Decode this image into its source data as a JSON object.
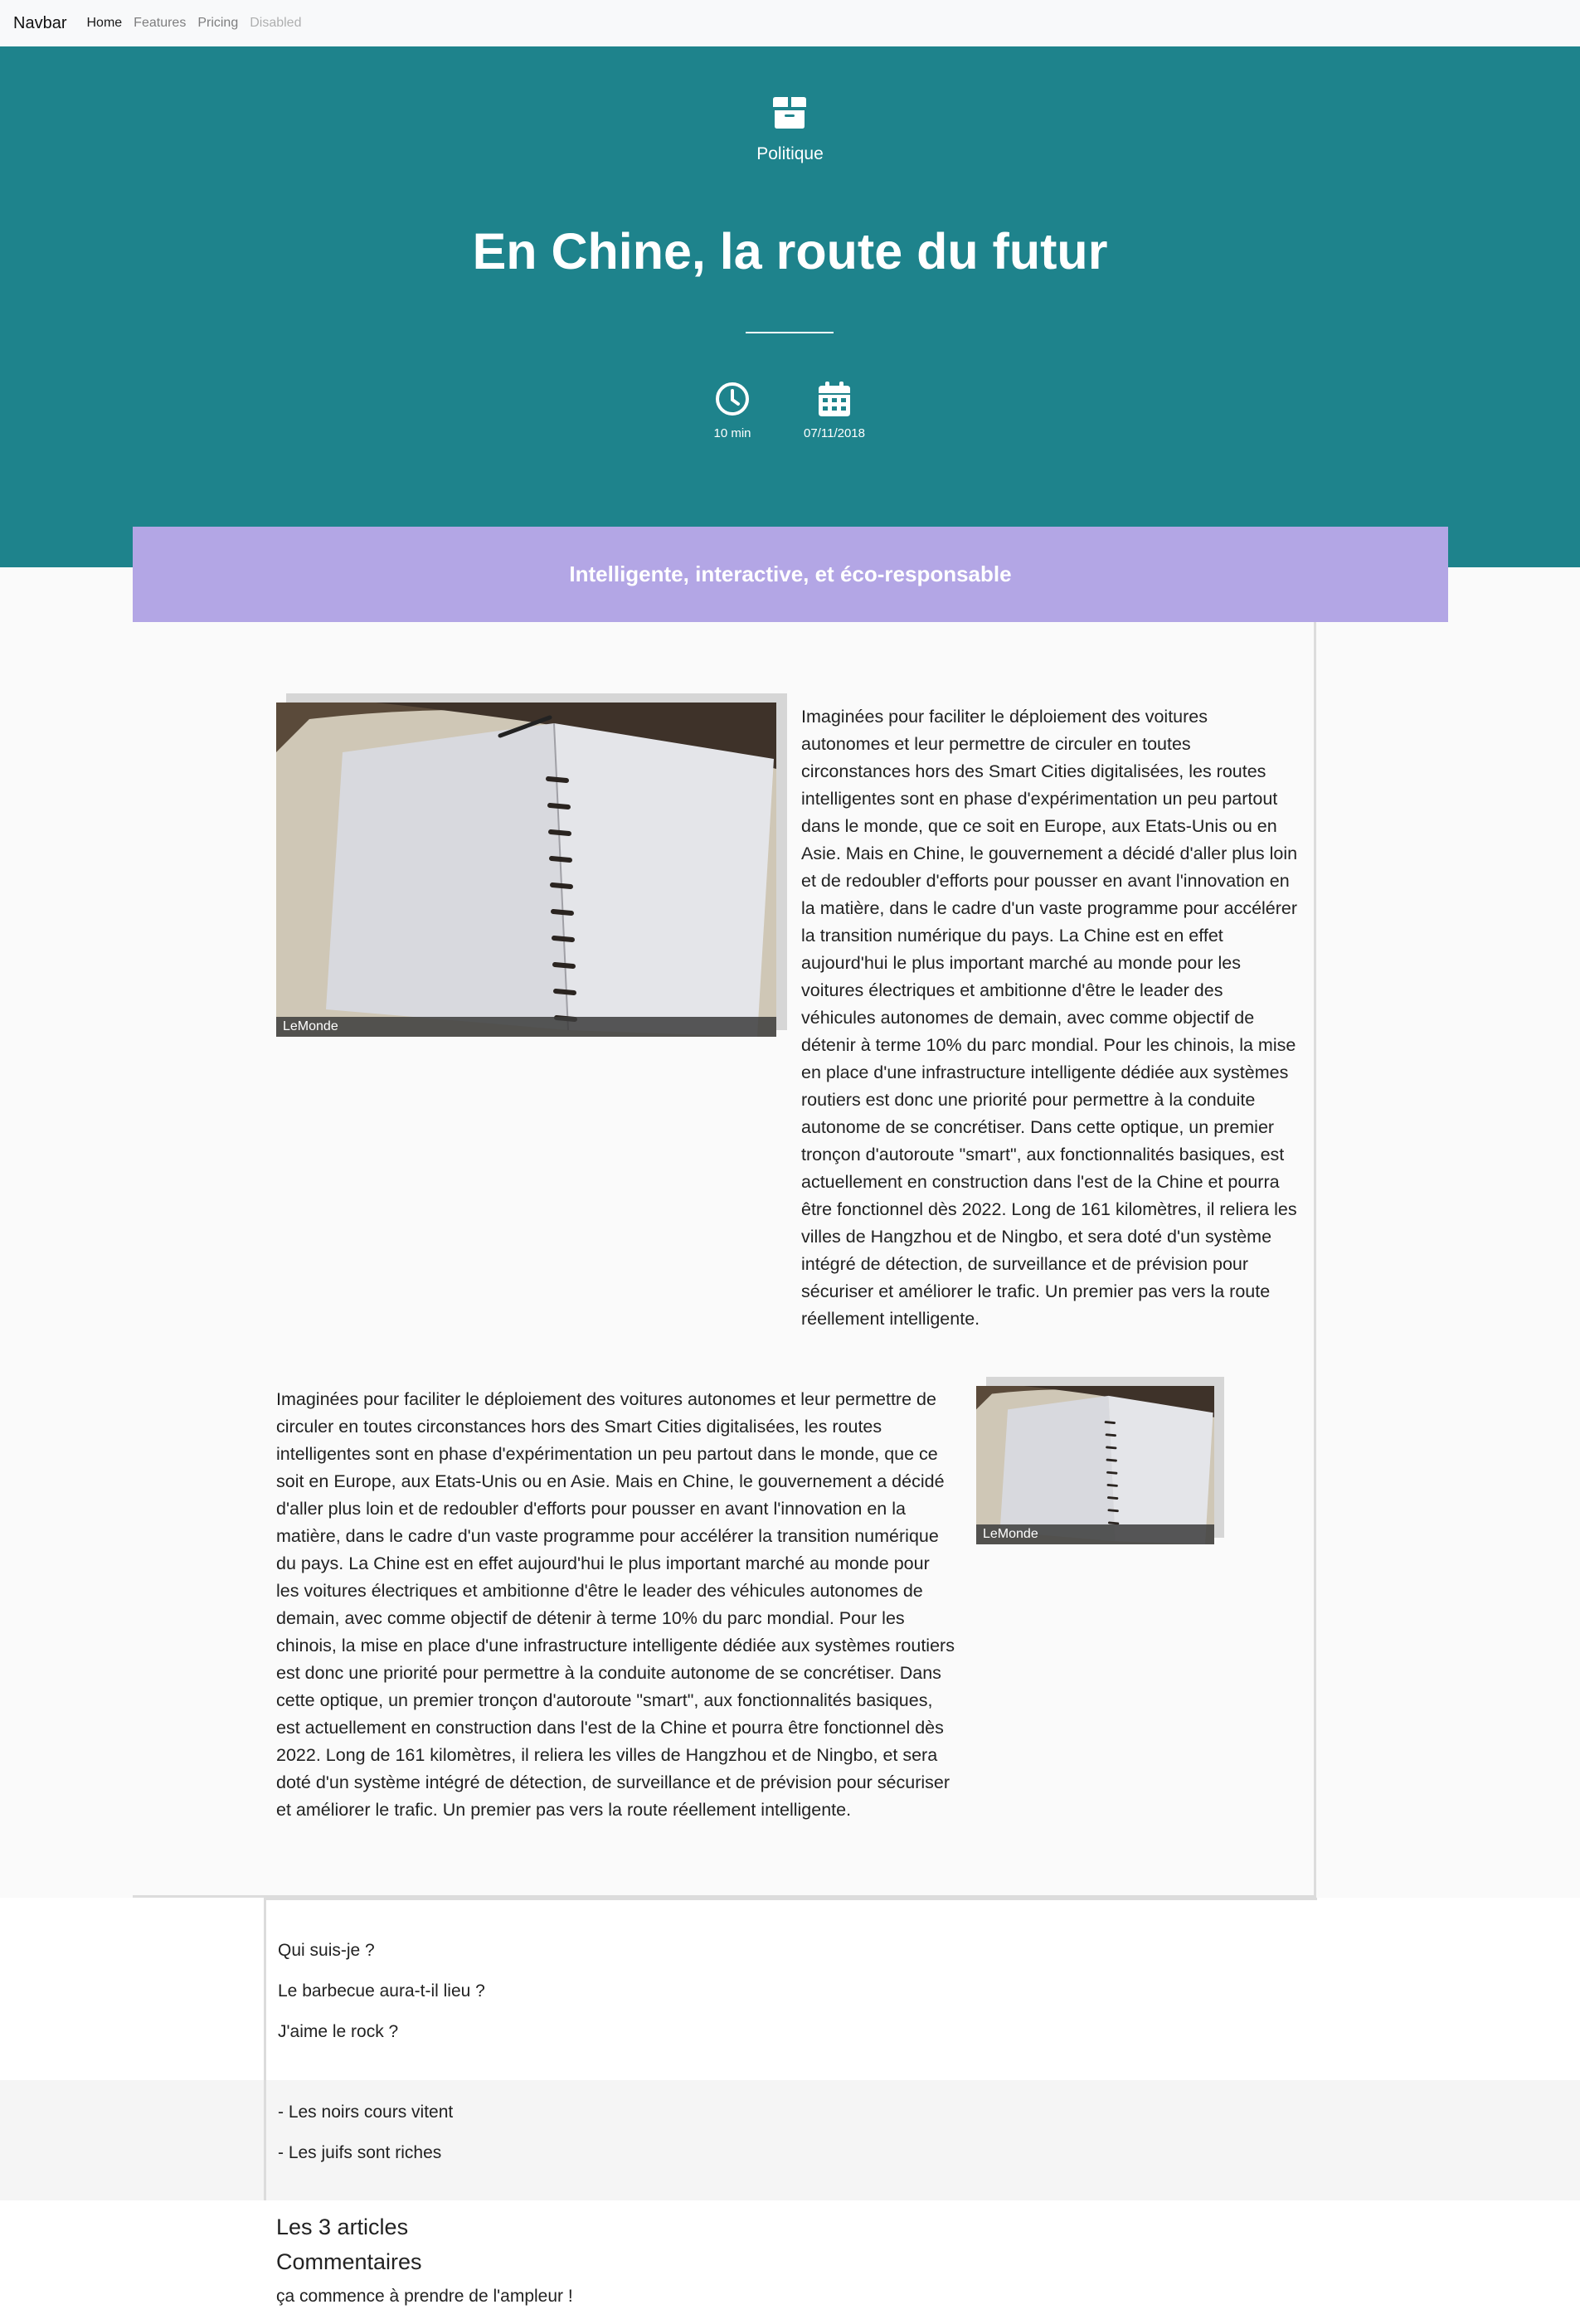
{
  "navbar": {
    "brand": "Navbar",
    "links": [
      {
        "label": "Home",
        "state": "active"
      },
      {
        "label": "Features",
        "state": "normal"
      },
      {
        "label": "Pricing",
        "state": "normal"
      },
      {
        "label": "Disabled",
        "state": "disabled"
      }
    ]
  },
  "hero": {
    "category_icon": "box-icon",
    "category": "Politique",
    "title": "En Chine, la route du futur",
    "reading_time_icon": "clock-icon",
    "reading_time": "10 min",
    "date_icon": "calendar-icon",
    "date": "07/11/2018",
    "background_color": "#1e838c"
  },
  "subtitle_bar": {
    "text": "Intelligente, interactive, et éco-responsable",
    "background_color": "#b3a6e5"
  },
  "article": {
    "image_caption_1": "LeMonde",
    "paragraph_1": "Imaginées pour faciliter le déploiement des voitures autonomes et leur permettre de circuler en toutes circonstances hors des Smart Cities digitalisées, les routes intelligentes sont en phase d'expérimentation un peu partout dans le monde, que ce soit en Europe, aux Etats-Unis ou en Asie. Mais en Chine, le gouvernement a décidé d'aller plus loin et de redoubler d'efforts pour pousser en avant l'innovation en la matière, dans le cadre d'un vaste programme pour accélérer la transition numérique du pays. La Chine est en effet aujourd'hui le plus important marché au monde pour les voitures électriques et ambitionne d'être le leader des véhicules autonomes de demain, avec comme objectif de détenir à terme 10% du parc mondial. Pour les chinois, la mise en place d'une infrastructure intelligente dédiée aux systèmes routiers est donc une priorité pour permettre à la conduite autonome de se concrétiser. Dans cette optique, un premier tronçon d'autoroute \"smart\", aux fonctionnalités basiques, est actuellement en construction dans l'est de la Chine et pourra être fonctionnel dès 2022. Long de 161 kilomètres, il reliera les villes de Hangzhou et de Ningbo, et sera doté d'un système intégré de détection, de surveillance et de prévision pour sécuriser et améliorer le trafic. Un premier pas vers la route réellement intelligente.",
    "image_caption_2": "LeMonde",
    "paragraph_2": "Imaginées pour faciliter le déploiement des voitures autonomes et leur permettre de circuler en toutes circonstances hors des Smart Cities digitalisées, les routes intelligentes sont en phase d'expérimentation un peu partout dans le monde, que ce soit en Europe, aux Etats-Unis ou en Asie. Mais en Chine, le gouvernement a décidé d'aller plus loin et de redoubler d'efforts pour pousser en avant l'innovation en la matière, dans le cadre d'un vaste programme pour accélérer la transition numérique du pays. La Chine est en effet aujourd'hui le plus important marché au monde pour les voitures électriques et ambitionne d'être le leader des véhicules autonomes de demain, avec comme objectif de détenir à terme 10% du parc mondial. Pour les chinois, la mise en place d'une infrastructure intelligente dédiée aux systèmes routiers est donc une priorité pour permettre à la conduite autonome de se concrétiser. Dans cette optique, un premier tronçon d'autoroute \"smart\", aux fonctionnalités basiques, est actuellement en construction dans l'est de la Chine et pourra être fonctionnel dès 2022. Long de 161 kilomètres, il reliera les villes de Hangzhou et de Ningbo, et sera doté d'un système intégré de détection, de surveillance et de prévision pour sécuriser et améliorer le trafic. Un premier pas vers la route réellement intelligente."
  },
  "questions": [
    "Qui suis-je ?",
    "Le barbecue aura-t-il lieu ?",
    "J'aime le rock ?"
  ],
  "statements": [
    "- Les noirs cours vitent",
    "- Les juifs sont riches"
  ],
  "footer": {
    "articles_heading": "Les 3 articles",
    "comments_heading": "Commentaires",
    "comment_1": "ça commence à prendre de l'ampleur !"
  }
}
